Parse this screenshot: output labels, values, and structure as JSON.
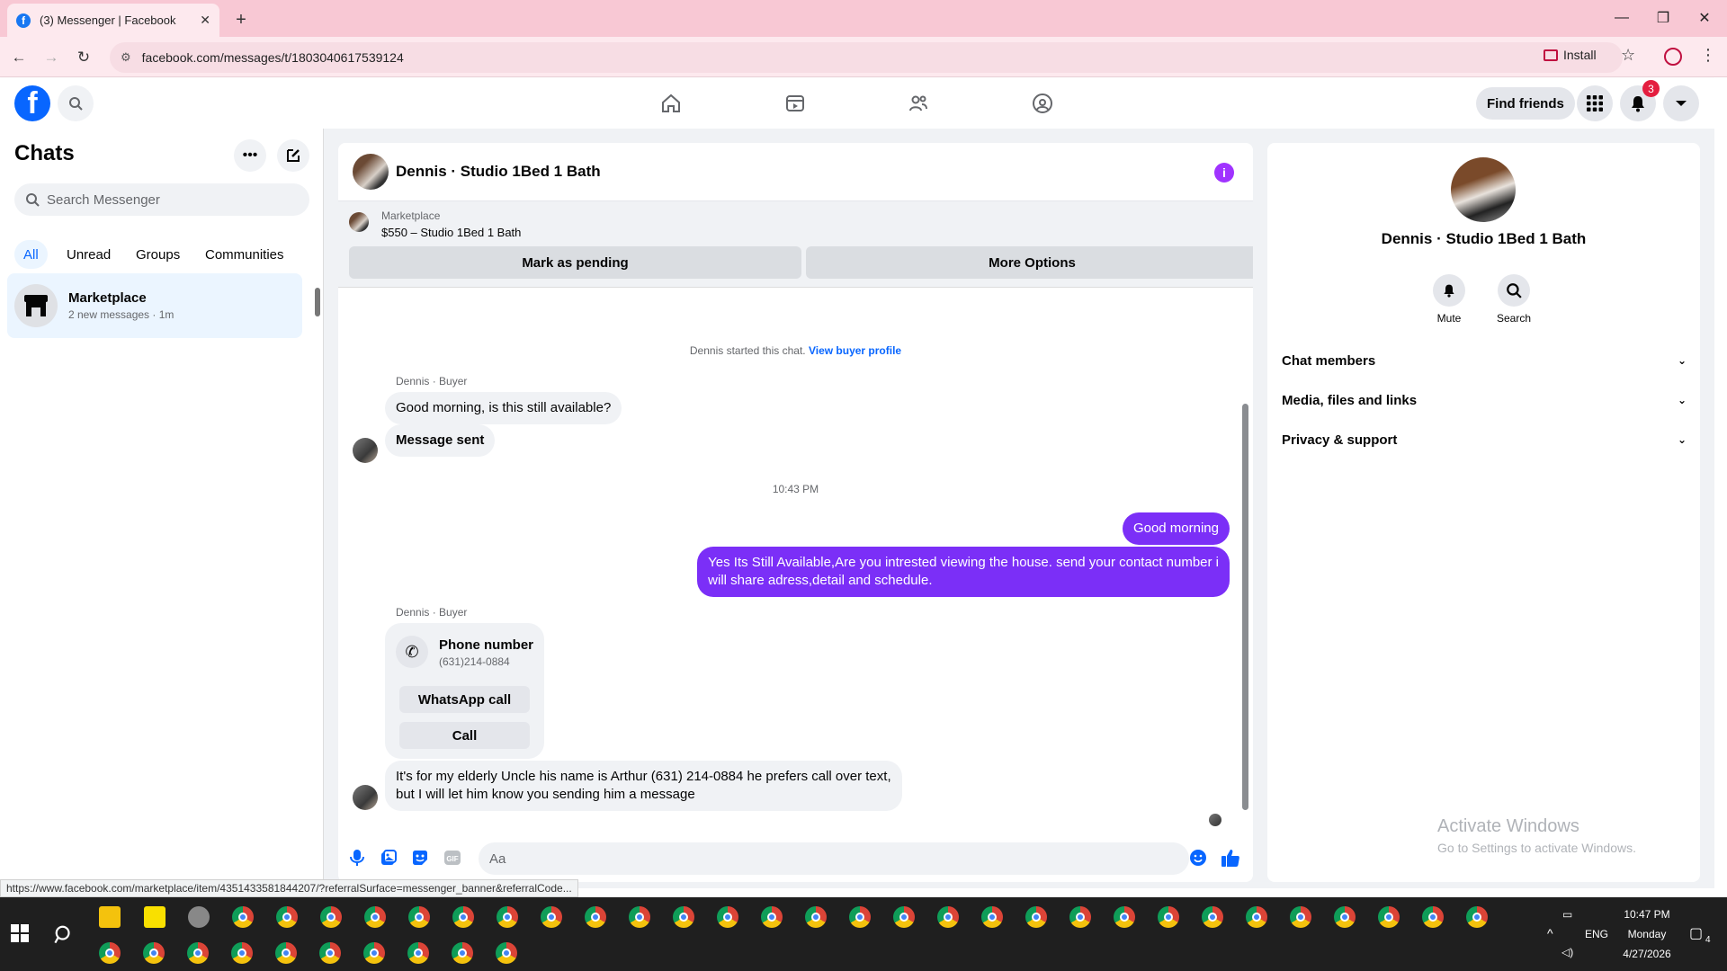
{
  "browser": {
    "tab_title": "(3) Messenger | Facebook",
    "url": "facebook.com/messages/t/1803040617539124",
    "install_label": "Install",
    "status_url": "https://www.facebook.com/marketplace/item/4351433581844207/?referralSurface=messenger_banner&referralCode..."
  },
  "header": {
    "find_friends": "Find friends",
    "notification_count": "3"
  },
  "sidebar": {
    "title": "Chats",
    "search_placeholder": "Search Messenger",
    "filters": [
      "All",
      "Unread",
      "Groups",
      "Communities"
    ],
    "active_filter": "All",
    "chats": [
      {
        "name": "Marketplace",
        "preview": "2 new messages · 1m"
      }
    ]
  },
  "conversation": {
    "title": "Dennis · Studio 1Bed 1 Bath",
    "banner": {
      "label": "Marketplace",
      "item": "$550 – Studio 1Bed 1 Bath",
      "btn_pending": "Mark as pending",
      "btn_more": "More Options"
    },
    "started_note": "Dennis started this chat.",
    "view_profile": "View buyer profile",
    "sender_label": "Dennis · Buyer",
    "msg1": "Good morning, is this still available?",
    "msg2": "Message sent",
    "timestamp": "10:43 PM",
    "out1": "Good morning",
    "out2_line1": "Yes Its Still Available,Are you intrested viewing the house. send your contact number i",
    "out2_line2": "will share adress,detail and schedule.",
    "sender_label2": "Dennis · Buyer",
    "phone_card": {
      "title": "Phone number",
      "number": "(631)214-0884",
      "btn_whatsapp": "WhatsApp call",
      "btn_call": "Call"
    },
    "last_line1": "It's for my elderly Uncle his name is Arthur (631) 214-0884 he prefers call over text,",
    "last_line2": "but I will let him know you sending him a message",
    "composer_placeholder": "Aa"
  },
  "right_panel": {
    "name": "Dennis · Studio 1Bed 1 Bath",
    "mute": "Mute",
    "search": "Search",
    "sections": [
      "Chat members",
      "Media, files and links",
      "Privacy & support"
    ],
    "watermark_title": "Activate Windows",
    "watermark_sub": "Go to Settings to activate Windows."
  },
  "taskbar": {
    "time": "10:47 PM",
    "day": "Monday",
    "date": "4/27/2026",
    "lang": "ENG",
    "action_count": "4"
  }
}
